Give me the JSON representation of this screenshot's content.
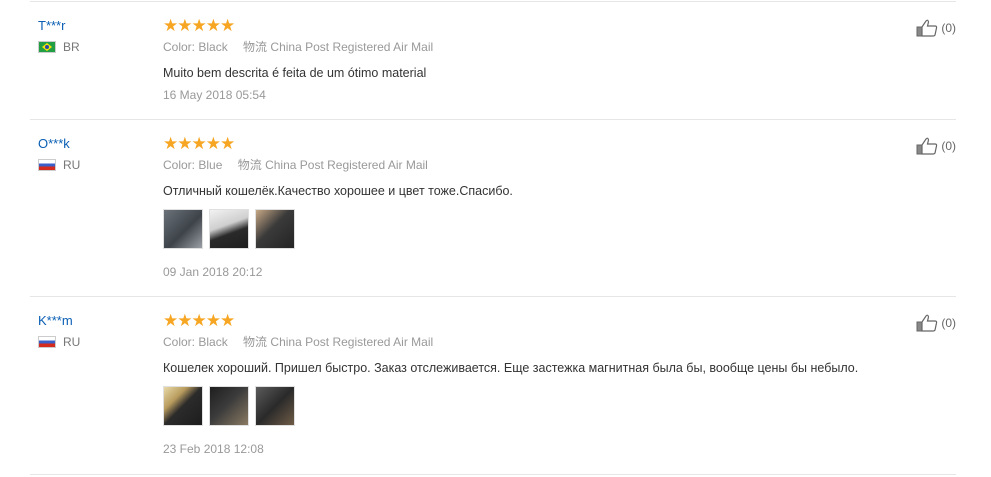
{
  "labels": {
    "color": "Color:",
    "shipping_icon": "物流"
  },
  "colors": {
    "username": "#0a5fb4",
    "stars": "#f6a623"
  },
  "reviews": [
    {
      "user": "T***r",
      "country": "BR",
      "rating": 5,
      "stars": "★★★★★",
      "color_value": "Black",
      "shipping": "China Post Registered Air Mail",
      "text": "Muito bem descrita é feita de um ótimo material",
      "date": "16 May 2018 05:54",
      "helpful": "(0)"
    },
    {
      "user": "O***k",
      "country": "RU",
      "rating": 5,
      "stars": "★★★★★",
      "color_value": "Blue",
      "shipping": "China Post Registered Air Mail",
      "text": "Отличный кошелёк.Качество хорошее и цвет тоже.Спасибо.",
      "date": "09 Jan 2018 20:12",
      "helpful": "(0)"
    },
    {
      "user": "K***m",
      "country": "RU",
      "rating": 5,
      "stars": "★★★★★",
      "color_value": "Black",
      "shipping": "China Post Registered Air Mail",
      "text": "Кошелек хороший. Пришел быстро. Заказ отслеживается. Еще застежка магнитная была бы, вообще цены бы небыло.",
      "date": "23 Feb 2018 12:08",
      "helpful": "(0)"
    }
  ]
}
